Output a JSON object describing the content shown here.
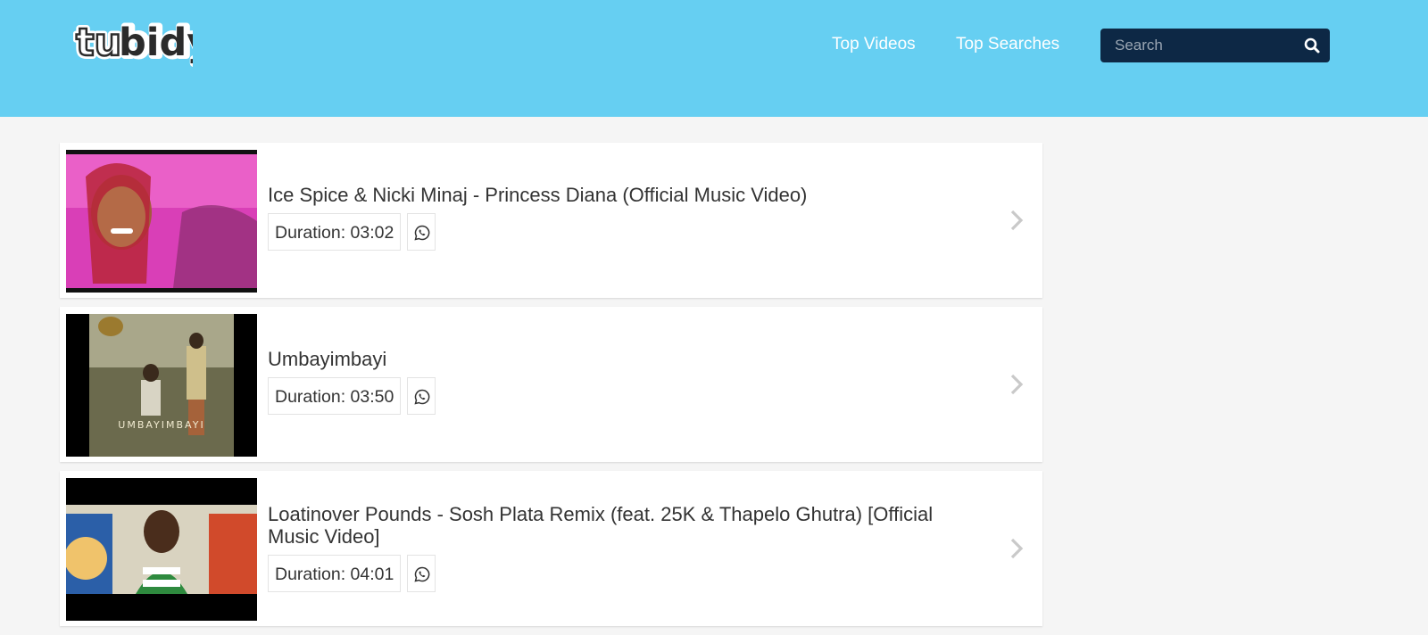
{
  "header": {
    "logo_text": "tubidy",
    "nav": [
      {
        "label": "Top Videos"
      },
      {
        "label": "Top Searches"
      }
    ],
    "search": {
      "placeholder": "Search",
      "value": ""
    }
  },
  "results": [
    {
      "title": "Ice Spice & Nicki Minaj - Princess Diana (Official Music Video)",
      "duration": "Duration: 03:02"
    },
    {
      "title": "Umbayimbayi",
      "duration": "Duration: 03:50"
    },
    {
      "title": "Loatinover Pounds - Sosh Plata Remix (feat. 25K & Thapelo Ghutra) [Official Music Video]",
      "duration": "Duration: 04:01"
    }
  ],
  "thumbnails": [
    {
      "text": "",
      "colors": {
        "primary": "#d93fb7",
        "secondary": "#f576d4"
      }
    },
    {
      "text": "UMBAYIMBAYI",
      "colors": {
        "primary": "#6b6a4d",
        "secondary": "#a9a78a"
      }
    },
    {
      "text": "",
      "colors": {
        "primary": "#f0c36b",
        "secondary": "#d14a2b"
      }
    }
  ],
  "colors": {
    "header": "#66cff2",
    "search": "#0d2845",
    "text": "#333333"
  }
}
